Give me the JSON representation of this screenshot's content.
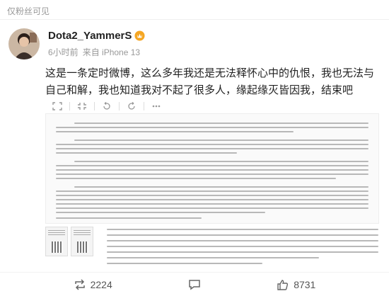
{
  "top": {
    "visibility": "仅粉丝可见"
  },
  "author": {
    "name": "Dota2_YammerS",
    "time": "6小时前",
    "source": "来自 iPhone 13"
  },
  "post": {
    "text": "这是一条定时微博，这么多年我还是无法释怀心中的仇恨，我也无法与自己和解，我也知道我对不起了很多人，缘起缘灭皆因我，结束吧"
  },
  "toolbar": {
    "icons": [
      "expand-icon",
      "shrink-icon",
      "rotate-left-icon",
      "rotate-right-icon",
      "more-icon"
    ]
  },
  "footer": {
    "repost_count": "2224",
    "like_count": "8731"
  },
  "colors": {
    "accent": "#ff8200",
    "text": "#222222",
    "muted": "#999999"
  }
}
